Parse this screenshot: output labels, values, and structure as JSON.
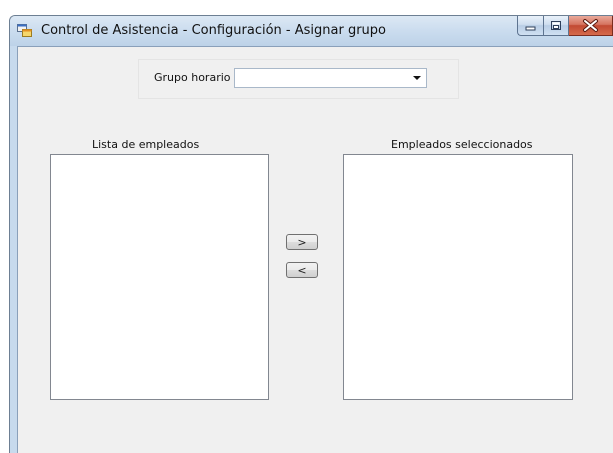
{
  "window": {
    "title": "Control de Asistencia - Configuración - Asignar grupo"
  },
  "group": {
    "label": "Grupo horario",
    "selected": ""
  },
  "lists": {
    "employees_label": "Lista de empleados",
    "selected_label": "Empleados seleccionados",
    "employees_items": [],
    "selected_items": []
  },
  "buttons": {
    "add_label": ">",
    "remove_label": "<"
  },
  "icons": {
    "app": "form-window-icon",
    "minimize": "minimize-icon",
    "maximize": "maximize-icon",
    "close": "close-icon",
    "combo_arrow": "chevron-down-icon"
  }
}
